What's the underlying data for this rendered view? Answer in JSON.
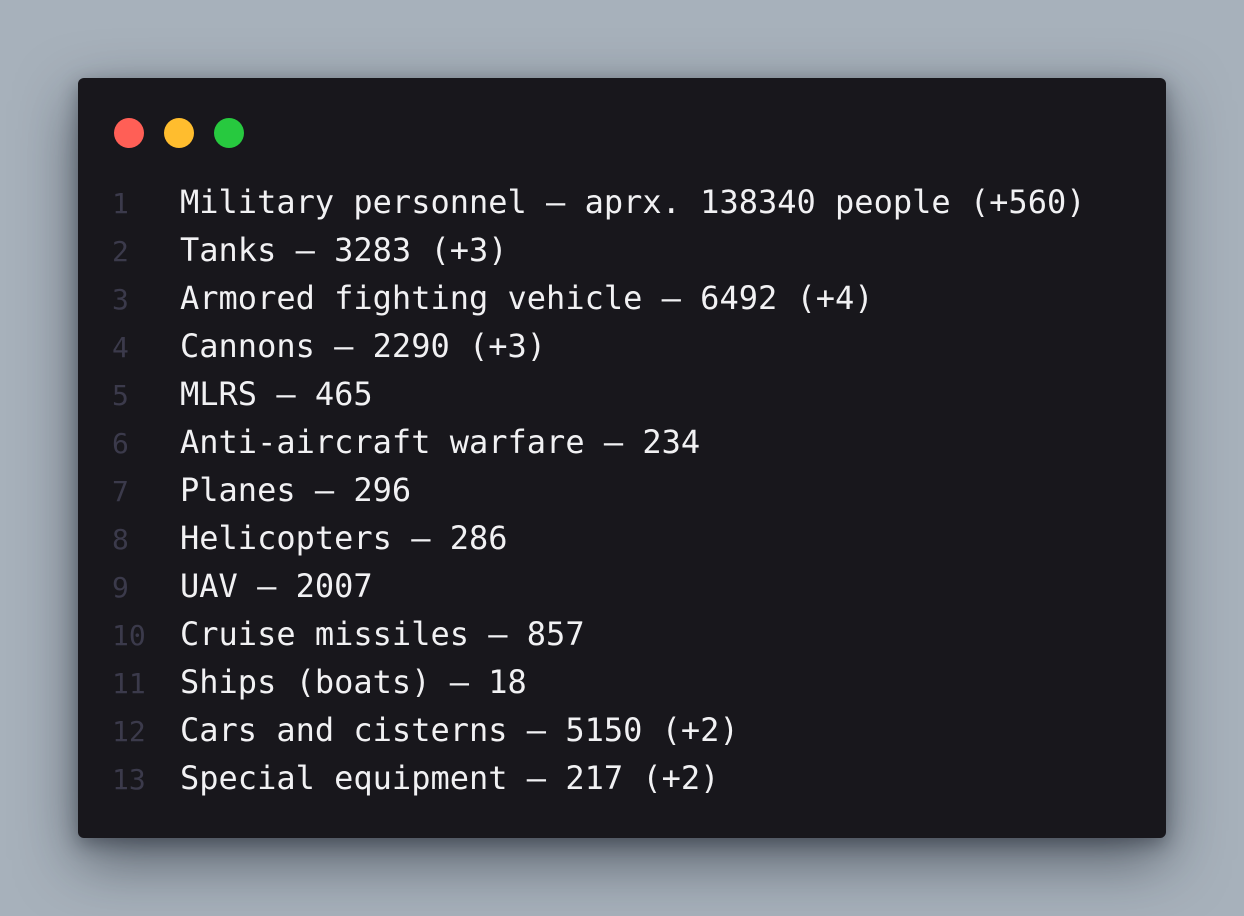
{
  "window_controls": {
    "close_color": "#ff5f56",
    "minimize_color": "#ffbd2e",
    "maximize_color": "#27c93f"
  },
  "code": {
    "lines": [
      {
        "number": "1",
        "text": "Military personnel — aprx. 138340 people (+560)"
      },
      {
        "number": "2",
        "text": "Tanks — 3283 (+3)"
      },
      {
        "number": "3",
        "text": "Armored fighting vehicle — 6492 (+4)"
      },
      {
        "number": "4",
        "text": "Cannons — 2290 (+3)"
      },
      {
        "number": "5",
        "text": "MLRS — 465"
      },
      {
        "number": "6",
        "text": "Anti-aircraft warfare — 234"
      },
      {
        "number": "7",
        "text": "Planes — 296"
      },
      {
        "number": "8",
        "text": "Helicopters — 286"
      },
      {
        "number": "9",
        "text": "UAV — 2007"
      },
      {
        "number": "10",
        "text": "Cruise missiles — 857"
      },
      {
        "number": "11",
        "text": "Ships (boats) — 18"
      },
      {
        "number": "12",
        "text": "Cars and cisterns — 5150 (+2)"
      },
      {
        "number": "13",
        "text": "Special equipment — 217 (+2)"
      }
    ]
  }
}
